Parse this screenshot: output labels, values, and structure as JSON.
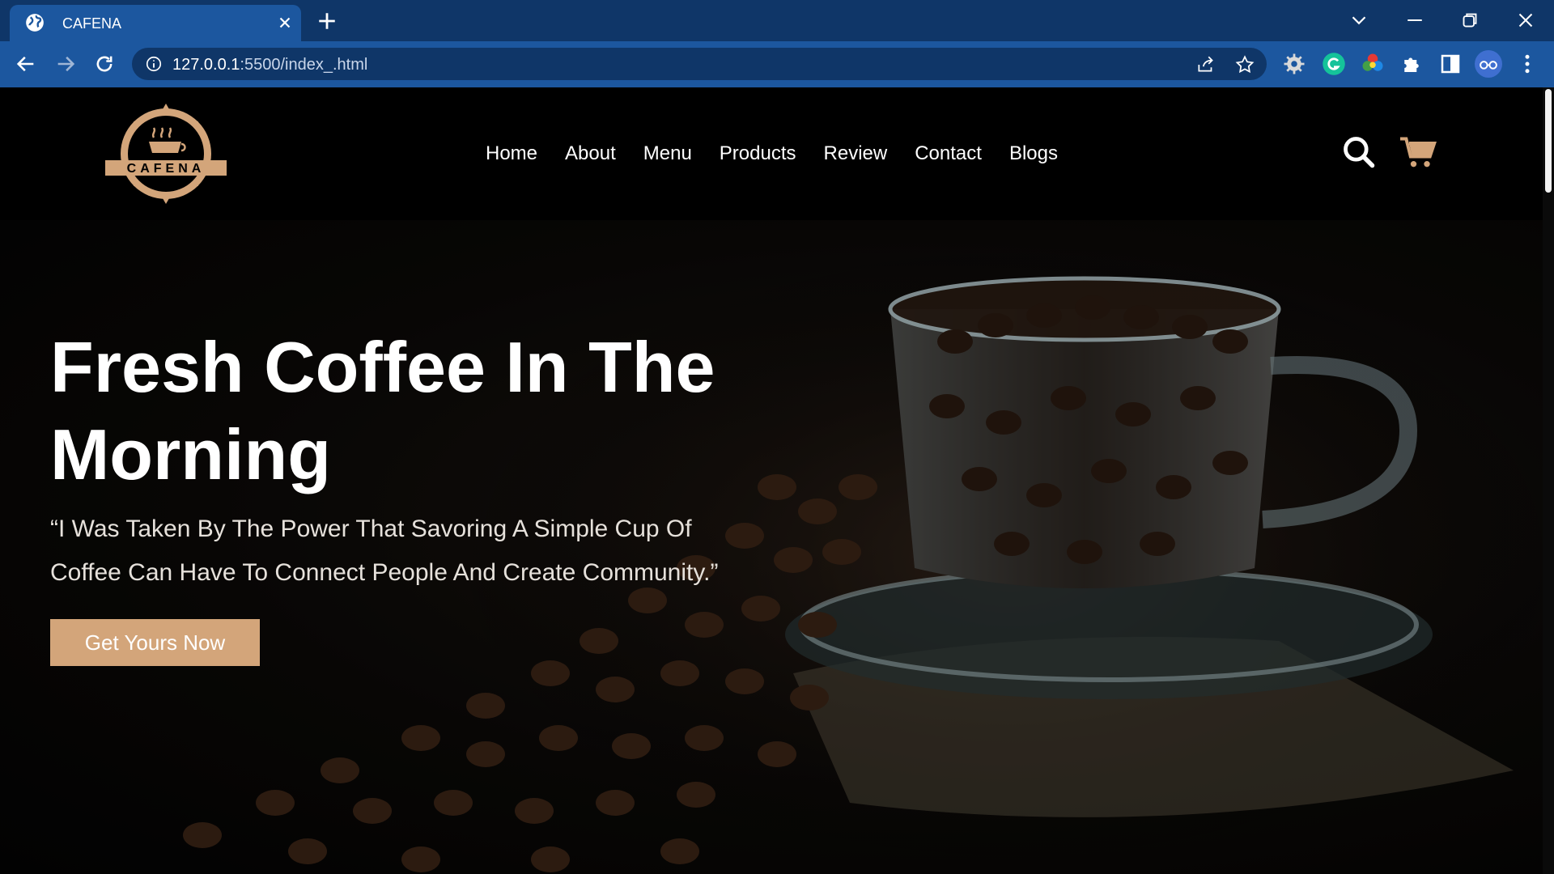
{
  "browser": {
    "tab_title": "CAFENA",
    "url_host": "127.0.0.1",
    "url_path": ":5500/index_.html"
  },
  "header": {
    "logo_text": "CAFENA",
    "nav": [
      "Home",
      "About",
      "Menu",
      "Products",
      "Review",
      "Contact",
      "Blogs"
    ]
  },
  "hero": {
    "title": "Fresh Coffee In The Morning",
    "quote": "“I Was Taken By The Power That Savoring A Simple Cup Of Coffee Can Have To Connect People And Create Community.”",
    "cta_label": "Get Yours Now"
  },
  "colors": {
    "accent": "#d3a57a",
    "chrome_dark": "#0f3668",
    "chrome": "#1c579f"
  }
}
